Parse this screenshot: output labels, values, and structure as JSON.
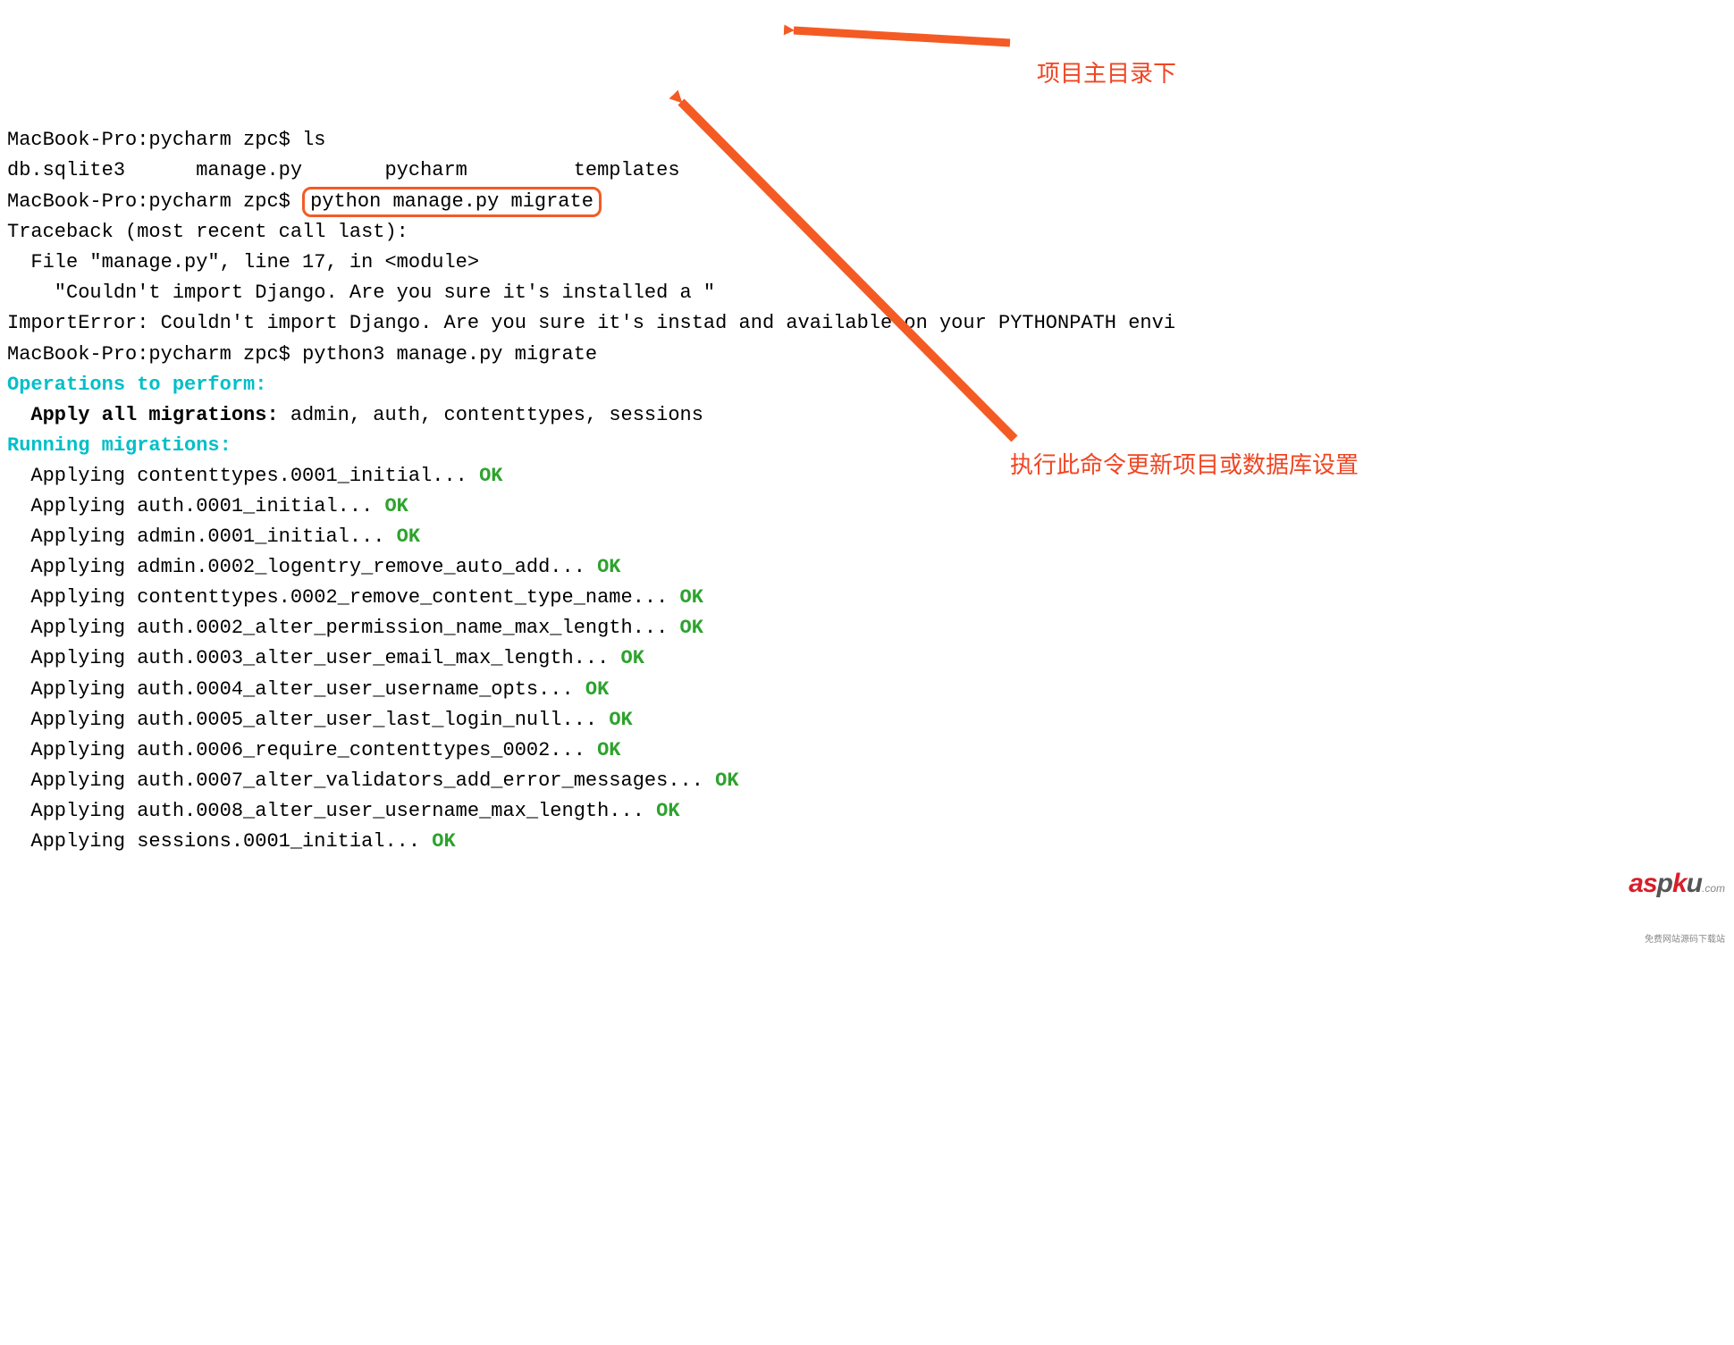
{
  "prompt1": "MacBook-Pro:pycharm zpc$ ",
  "cmd1": "ls",
  "ls_out": "db.sqlite3      manage.py       pycharm         templates",
  "prompt2": "MacBook-Pro:pycharm zpc$ ",
  "cmd2_boxed": "python manage.py migrate",
  "traceback_head": "Traceback (most recent call last):",
  "tb_line1": "  File \"manage.py\", line 17, in <module>",
  "tb_line2": "    \"Couldn't import Django. Are you sure it's installed a",
  "tb_line2_tail": " \"",
  "tb_line3": "ImportError: Couldn't import Django. Are you sure it's insta",
  "tb_line3_tail": "d and available on your PYTHONPATH envi",
  "prompt3": "MacBook-Pro:pycharm zpc$ ",
  "cmd3": "python3 manage.py migrate",
  "ops_header": "Operations to perform:",
  "apply_label": "  Apply all migrations: ",
  "apply_list": "admin, auth, contenttypes, sessions",
  "running_header": "Running migrations:",
  "migrations": [
    "  Applying contenttypes.0001_initial... ",
    "  Applying auth.0001_initial... ",
    "  Applying admin.0001_initial... ",
    "  Applying admin.0002_logentry_remove_auto_add... ",
    "  Applying contenttypes.0002_remove_content_type_name... ",
    "  Applying auth.0002_alter_permission_name_max_length... ",
    "  Applying auth.0003_alter_user_email_max_length... ",
    "  Applying auth.0004_alter_user_username_opts... ",
    "  Applying auth.0005_alter_user_last_login_null... ",
    "  Applying auth.0006_require_contenttypes_0002... ",
    "  Applying auth.0007_alter_validators_add_error_messages... ",
    "  Applying auth.0008_alter_user_username_max_length... ",
    "  Applying sessions.0001_initial... "
  ],
  "ok": "OK",
  "annotation1": "项目主目录下",
  "annotation2": "执行此命令更新项目或数据库设置",
  "watermark_brand": "aspku",
  "watermark_dom": ".com",
  "watermark_tag": "免费网站源码下载站",
  "colors": {
    "highlight": "#f45b24",
    "annotation_text": "#f04522",
    "cyan": "#00bfc8",
    "green": "#2da32d"
  }
}
